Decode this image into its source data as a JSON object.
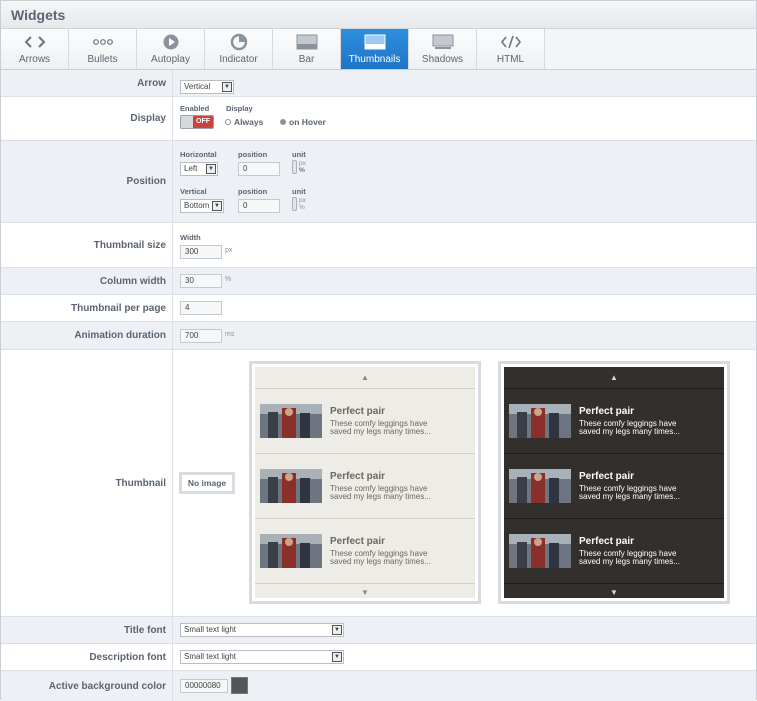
{
  "window": {
    "title": "Widgets"
  },
  "tabs": [
    {
      "label": "Arrows",
      "icon": "arrows-icon"
    },
    {
      "label": "Bullets",
      "icon": "bullets-icon"
    },
    {
      "label": "Autoplay",
      "icon": "play-icon"
    },
    {
      "label": "Indicator",
      "icon": "pie-indicator-icon"
    },
    {
      "label": "Bar",
      "icon": "bar-icon"
    },
    {
      "label": "Thumbnails",
      "icon": "thumbnails-icon",
      "active": true
    },
    {
      "label": "Shadows",
      "icon": "shadows-icon"
    },
    {
      "label": "HTML",
      "icon": "code-icon"
    }
  ],
  "arrow": {
    "label": "Arrow",
    "value": "Vertical"
  },
  "display": {
    "label": "Display",
    "enabled_label": "Enabled",
    "display_label": "Display",
    "toggle": "OFF",
    "option_always": "Always",
    "option_hover": "on Hover",
    "selected": "on Hover"
  },
  "position": {
    "label": "Position",
    "horizontal_label": "Horizontal",
    "horizontal_value": "Left",
    "vertical_label": "Vertical",
    "vertical_value": "Bottom",
    "position_label": "position",
    "h_position": "0",
    "v_position": "0",
    "unit_label": "unit",
    "unit_px": "px",
    "unit_pct": "%"
  },
  "thumbnail_size": {
    "label": "Thumbnail size",
    "width_label": "Width",
    "value": "300",
    "unit": "px"
  },
  "column_width": {
    "label": "Column width",
    "value": "30",
    "unit": "%"
  },
  "per_page": {
    "label": "Thumbnail per page",
    "value": "4"
  },
  "animation": {
    "label": "Animation duration",
    "value": "700",
    "unit": "ms"
  },
  "thumbnail": {
    "label": "Thumbnail",
    "no_image": "No image",
    "item_title": "Perfect pair",
    "item_desc_1": "These comfy leggings have",
    "item_desc_2": "saved my legs many times..."
  },
  "title_font": {
    "label": "Title font",
    "value": "Small text light"
  },
  "description_font": {
    "label": "Description font",
    "value": "Small text light"
  },
  "active_bg": {
    "label": "Active background color",
    "value": "00000080"
  },
  "colors": {
    "accent": "#2a84d6",
    "light_panel": "#eeece6",
    "dark_panel": "#332f2c",
    "toggle_off": "#c9443f"
  }
}
